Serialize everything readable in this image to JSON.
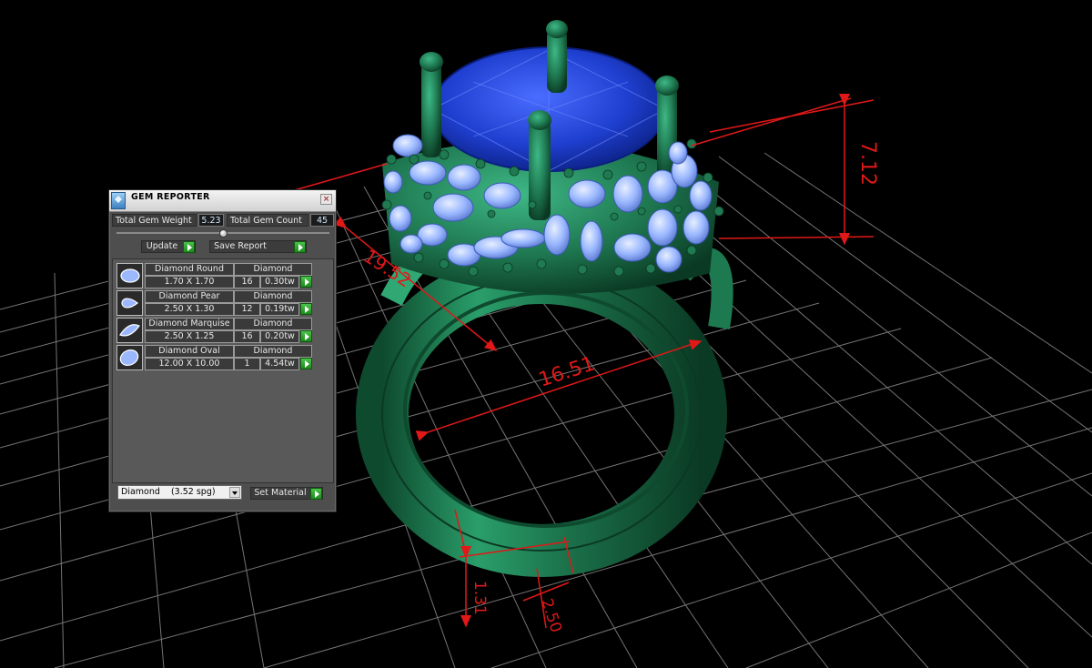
{
  "viewport": {
    "dimensions": [
      "7.12",
      "19.52",
      "16.51",
      "1.31",
      "2.50"
    ],
    "colors": {
      "background": "#000000",
      "grid": "#8a8a8a",
      "metal": "#1f7a52",
      "center_stone": "#1f3fd0",
      "accent_stones": "#9bb8ff",
      "dimension_lines": "#e01818"
    }
  },
  "gem_reporter": {
    "title": "GEM REPORTER",
    "close_glyph": "×",
    "total_weight_label": "Total Gem Weight",
    "total_weight_value": "5.23",
    "total_count_label": "Total Gem Count",
    "total_count_value": "45",
    "update_label": "Update",
    "save_report_label": "Save Report",
    "gems": [
      {
        "shape": "Diamond Round",
        "material": "Diamond",
        "size": "1.70 X 1.70",
        "count": "16",
        "weight": "0.30tw"
      },
      {
        "shape": "Diamond Pear",
        "material": "Diamond",
        "size": "2.50 X 1.30",
        "count": "12",
        "weight": "0.19tw"
      },
      {
        "shape": "Diamond Marquise",
        "material": "Diamond",
        "size": "2.50 X 1.25",
        "count": "16",
        "weight": "0.20tw"
      },
      {
        "shape": "Diamond Oval",
        "material": "Diamond",
        "size": "12.00 X 10.00",
        "count": "1",
        "weight": "4.54tw"
      }
    ],
    "material_selected": "Diamond    (3.52 spg)",
    "set_material_label": "Set Material"
  }
}
